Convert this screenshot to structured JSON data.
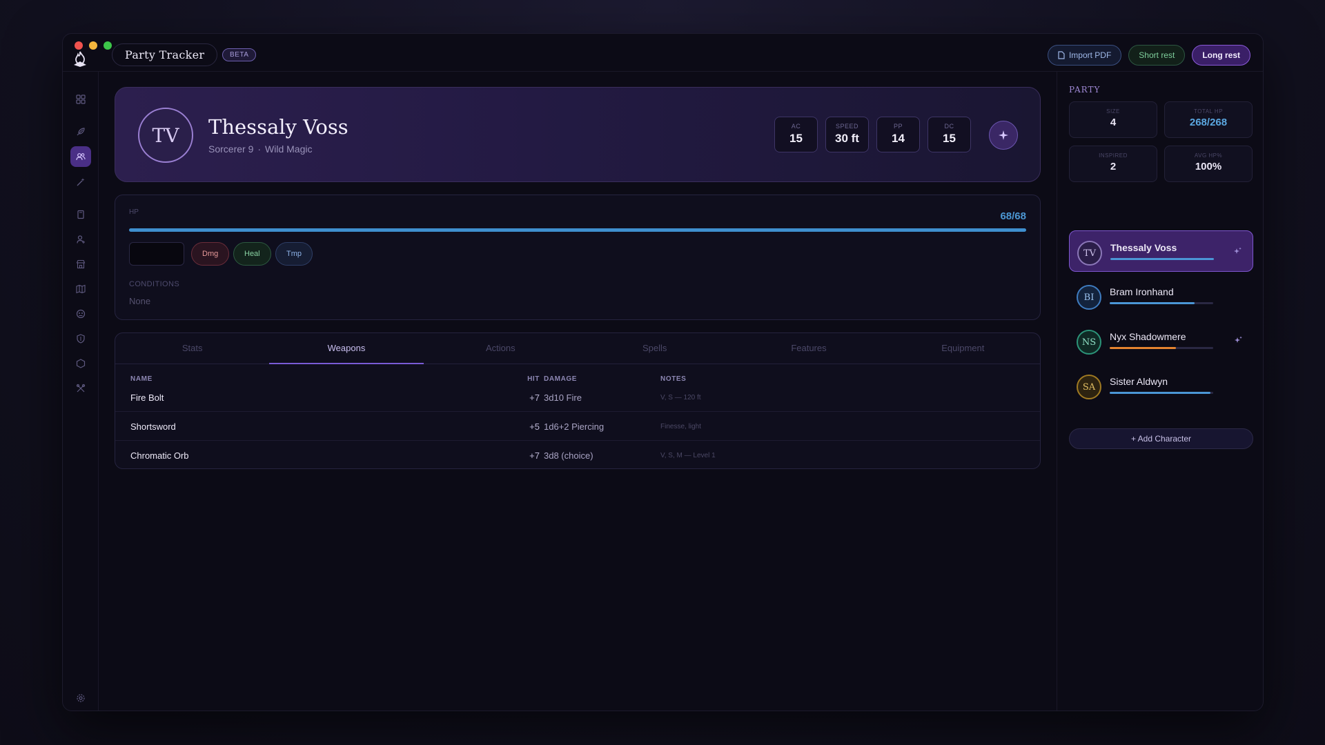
{
  "app": {
    "title": "Party Tracker",
    "badge": "BETA"
  },
  "toolbar": {
    "import_label": "Import PDF",
    "short_rest_label": "Short rest",
    "long_rest_label": "Long rest"
  },
  "sidebar": {
    "icons": [
      "dashboard-icon",
      "feather-icon",
      "party-icon",
      "wand-icon",
      "book-icon",
      "npc-icon",
      "shop-icon",
      "map-icon",
      "monster-icon",
      "shield-icon",
      "dice-icon",
      "tools-icon"
    ],
    "active": "party-icon",
    "settings_icon": "gear-icon"
  },
  "character": {
    "initials": "TV",
    "name": "Thessaly Voss",
    "class_level": "Sorcerer 9",
    "separator": "·",
    "subclass": "Wild Magic",
    "stats": [
      {
        "label": "AC",
        "value": "15"
      },
      {
        "label": "SPEED",
        "value": "30 ft"
      },
      {
        "label": "PP",
        "value": "14"
      },
      {
        "label": "DC",
        "value": "15"
      }
    ]
  },
  "hp": {
    "label": "HP",
    "display": "68/68",
    "fraction": 1.0,
    "input_value": "",
    "damage_label": "Dmg",
    "heal_label": "Heal",
    "temp_label": "Tmp",
    "conditions_label": "CONDITIONS",
    "conditions_value": "None"
  },
  "tabs": {
    "items": [
      "Stats",
      "Weapons",
      "Actions",
      "Spells",
      "Features",
      "Equipment"
    ],
    "active_index": 1
  },
  "weapons": {
    "headers": {
      "name": "NAME",
      "hit": "HIT",
      "damage": "DAMAGE",
      "notes": "NOTES"
    },
    "rows": [
      {
        "name": "Fire Bolt",
        "hit": "+7",
        "damage": "3d10 Fire",
        "notes": "V, S — 120 ft"
      },
      {
        "name": "Shortsword",
        "hit": "+5",
        "damage": "1d6+2 Piercing",
        "notes": "Finesse, light"
      },
      {
        "name": "Chromatic Orb",
        "hit": "+7",
        "damage": "3d8 (choice)",
        "notes": "V, S, M — Level 1"
      }
    ]
  },
  "party": {
    "title": "PARTY",
    "stats": {
      "size_label": "SIZE",
      "size_value": "4",
      "total_hp_label": "TOTAL HP",
      "total_hp_value": "268/268",
      "inspired_label": "INSPIRED",
      "inspired_value": "2",
      "avg_hp_label": "AVG HP%",
      "avg_hp_value": "100%"
    },
    "members": [
      {
        "initials": "TV",
        "name": "Thessaly Voss",
        "hp_fraction": 1.0,
        "bar_color": "#4b96d6",
        "inspired": true,
        "selected": true
      },
      {
        "initials": "BI",
        "name": "Bram Ironhand",
        "hp_fraction": 0.82,
        "bar_color": "#4b96d6",
        "inspired": false,
        "selected": false
      },
      {
        "initials": "NS",
        "name": "Nyx Shadowmere",
        "hp_fraction": 0.64,
        "bar_color": "#e5832f",
        "inspired": true,
        "selected": false
      },
      {
        "initials": "SA",
        "name": "Sister Aldwyn",
        "hp_fraction": 0.97,
        "bar_color": "#4b96d6",
        "inspired": false,
        "selected": false
      }
    ],
    "add_label": "Add Character"
  },
  "colors": {
    "accent": "#7a5bd6",
    "hp_blue": "#3f8fcf",
    "danger": "#e89a9a",
    "heal": "#8ad3a3"
  }
}
